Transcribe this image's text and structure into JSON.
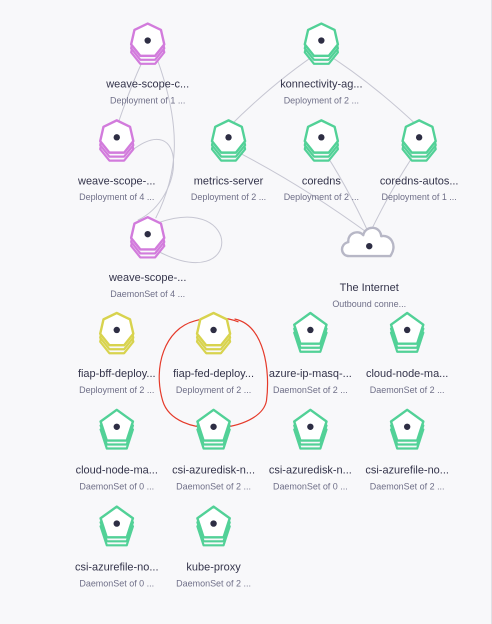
{
  "graph": {
    "colors": {
      "purple": "#d27bdc",
      "green": "#52d197",
      "yellow": "#d8d34e",
      "cloud": "#b7b7c6",
      "dot": "#2e2e44",
      "edge": "#c6c6d2",
      "annotation": "#e53a2a"
    },
    "nodes": [
      {
        "id": "weave-c",
        "shape": "stack-heptagon",
        "color": "purple",
        "label": "weave-scope-c...",
        "sublabel": "Deployment of 1 ..."
      },
      {
        "id": "konn",
        "shape": "stack-heptagon",
        "color": "green",
        "label": "konnectivity-ag...",
        "sublabel": "Deployment of 2 ..."
      },
      {
        "id": "weave-a",
        "shape": "stack-heptagon",
        "color": "purple",
        "label": "weave-scope-...",
        "sublabel": "Deployment of 4 ..."
      },
      {
        "id": "metrics",
        "shape": "stack-heptagon",
        "color": "green",
        "label": "metrics-server",
        "sublabel": "Deployment of 2 ..."
      },
      {
        "id": "coredns",
        "shape": "stack-heptagon",
        "color": "green",
        "label": "coredns",
        "sublabel": "Deployment of 2 ..."
      },
      {
        "id": "autosc",
        "shape": "stack-heptagon",
        "color": "green",
        "label": "coredns-autos...",
        "sublabel": "Deployment of 1 ..."
      },
      {
        "id": "weave-ds",
        "shape": "stack-heptagon",
        "color": "purple",
        "label": "weave-scope-...",
        "sublabel": "DaemonSet of 4 ..."
      },
      {
        "id": "internet",
        "shape": "cloud",
        "color": "cloud",
        "label": "The Internet",
        "sublabel": "Outbound conne..."
      },
      {
        "id": "fiap-bff",
        "shape": "stack-heptagon",
        "color": "yellow",
        "label": "fiap-bff-deploy...",
        "sublabel": "Deployment of 2 ..."
      },
      {
        "id": "fiap-fed",
        "shape": "stack-heptagon",
        "color": "yellow",
        "label": "fiap-fed-deploy...",
        "sublabel": "Deployment of 2 ..."
      },
      {
        "id": "azure-ip",
        "shape": "stack-pentagon",
        "color": "green",
        "label": "azure-ip-masq-...",
        "sublabel": "DaemonSet of 2 ..."
      },
      {
        "id": "cloud-node-1",
        "shape": "stack-pentagon",
        "color": "green",
        "label": "cloud-node-ma...",
        "sublabel": "DaemonSet of 2 ..."
      },
      {
        "id": "cloud-node-2",
        "shape": "stack-pentagon",
        "color": "green",
        "label": "cloud-node-ma...",
        "sublabel": "DaemonSet of 0 ..."
      },
      {
        "id": "csi-disk-1",
        "shape": "stack-pentagon",
        "color": "green",
        "label": "csi-azuredisk-n...",
        "sublabel": "DaemonSet of 2 ..."
      },
      {
        "id": "csi-disk-2",
        "shape": "stack-pentagon",
        "color": "green",
        "label": "csi-azuredisk-n...",
        "sublabel": "DaemonSet of 0 ..."
      },
      {
        "id": "csi-file-1",
        "shape": "stack-pentagon",
        "color": "green",
        "label": "csi-azurefile-no...",
        "sublabel": "DaemonSet of 2 ..."
      },
      {
        "id": "csi-file-2",
        "shape": "stack-pentagon",
        "color": "green",
        "label": "csi-azurefile-no...",
        "sublabel": "DaemonSet of 0 ..."
      },
      {
        "id": "kube-proxy",
        "shape": "stack-pentagon",
        "color": "green",
        "label": "kube-proxy",
        "sublabel": "DaemonSet of 2 ..."
      }
    ],
    "edges": [
      [
        "weave-c",
        "weave-a"
      ],
      [
        "weave-c",
        "weave-ds"
      ],
      [
        "weave-a",
        "weave-ds"
      ],
      [
        "weave-ds",
        "weave-ds"
      ],
      [
        "konn",
        "metrics"
      ],
      [
        "konn",
        "autosc"
      ],
      [
        "metrics",
        "internet"
      ],
      [
        "coredns",
        "internet"
      ],
      [
        "autosc",
        "internet"
      ]
    ],
    "annotation": {
      "type": "hand-drawn-circle",
      "target": "fiap-fed"
    }
  }
}
